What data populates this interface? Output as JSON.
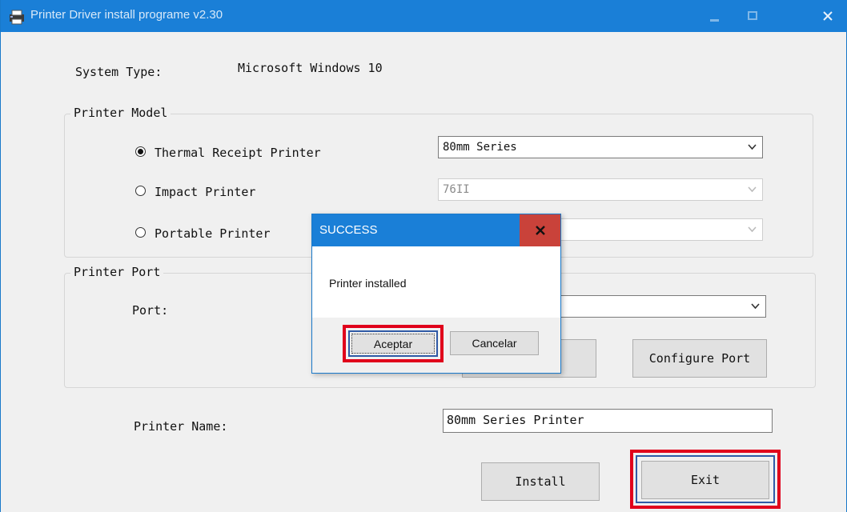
{
  "window": {
    "title": "Printer Driver install programe v2.30"
  },
  "system": {
    "label": "System Type:",
    "value": "Microsoft Windows 10"
  },
  "printer_model": {
    "legend": "Printer Model",
    "options": [
      {
        "label": "Thermal Receipt Printer",
        "checked": true,
        "combo": "80mm Series",
        "enabled": true
      },
      {
        "label": "Impact Printer",
        "checked": false,
        "combo": "76II",
        "enabled": false
      },
      {
        "label": "Portable Printer",
        "checked": false,
        "combo": "",
        "enabled": false
      }
    ]
  },
  "printer_port": {
    "legend": "Printer Port",
    "port_label": "Port:",
    "port_value": "",
    "configure_label": "Configure Port"
  },
  "printer_name": {
    "label": "Printer Name:",
    "value": "80mm Series Printer"
  },
  "buttons": {
    "install": "Install",
    "exit": "Exit"
  },
  "dialog": {
    "title": "SUCCESS",
    "message": "Printer installed",
    "ok_label": "Aceptar",
    "cancel_label": "Cancelar"
  },
  "colors": {
    "titlebar": "#1a7fd7",
    "highlight": "#e0001b",
    "dialog_close": "#c9423a"
  }
}
